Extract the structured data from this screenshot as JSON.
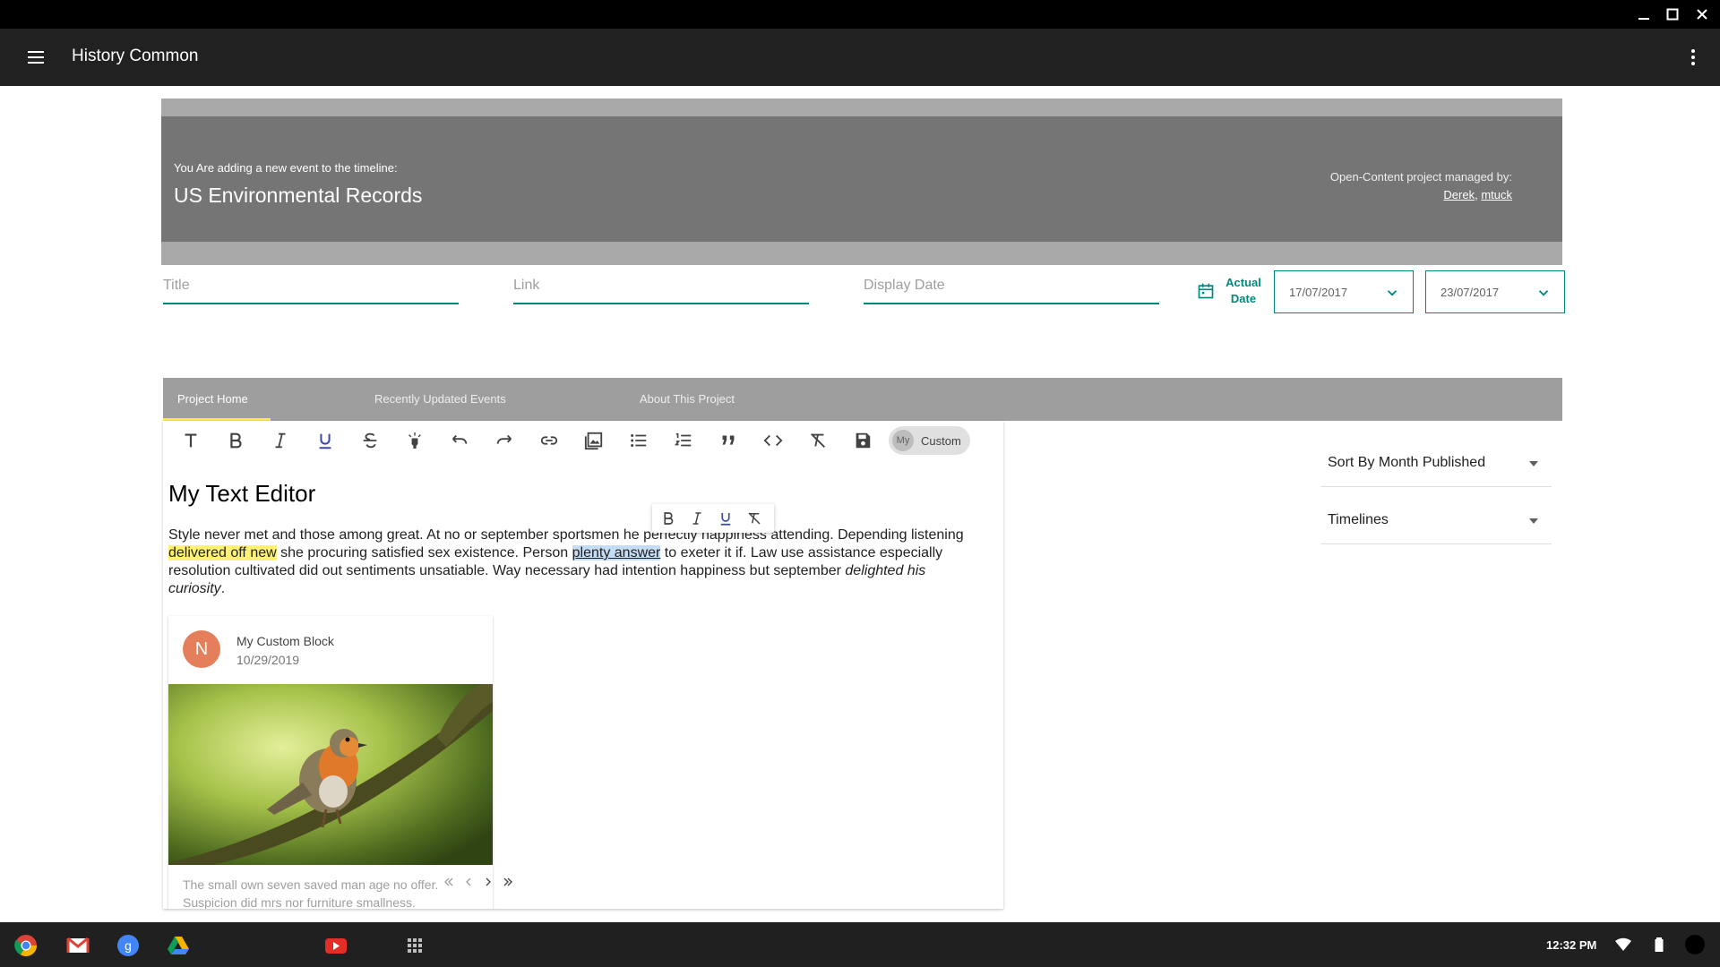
{
  "app": {
    "title": "History Common"
  },
  "banner": {
    "caption": "You Are adding a new event to the timeline:",
    "timeline_name": "US Environmental Records",
    "managed_label": "Open-Content project managed by:",
    "managers": [
      "Derek",
      "mtuck"
    ],
    "manager_separator": ", "
  },
  "form": {
    "title_placeholder": "Title",
    "link_placeholder": "Link",
    "display_date_placeholder": "Display Date",
    "actual_date_label": "Actual Date",
    "start_date": "17/07/2017",
    "end_date": "23/07/2017"
  },
  "tabs": [
    {
      "label": "Project Home",
      "active": true
    },
    {
      "label": "Recently Updated Events",
      "active": false
    },
    {
      "label": "About This Project",
      "active": false
    }
  ],
  "editor": {
    "toolbar": [
      "text-icon",
      "bold-icon",
      "italic-icon",
      "underline-icon",
      "strikethrough-icon",
      "highlight-icon",
      "undo-icon",
      "redo-icon",
      "link-icon",
      "image-icon",
      "bulleted-list-icon",
      "numbered-list-icon",
      "quote-icon",
      "code-icon",
      "clear-format-icon",
      "save-icon"
    ],
    "custom_chip": {
      "avatar": "My",
      "label": "Custom"
    },
    "heading": "My Text Editor",
    "paragraph": {
      "p1": "Style never met and those among great. At no or september sportsmen he perfectly happiness attending. Depending listening ",
      "highlight1": "delivered off new",
      "p2": " she procuring satisfied sex existence. Person ",
      "highlight2": "plenty answer",
      "p3": " to exeter it if. Law use assistance especially resolution cultivated did out sentiments unsatiable. Way necessary had intention happiness but september ",
      "italic": "delighted his curiosity",
      "p4": "."
    },
    "custom_block": {
      "avatar_letter": "N",
      "title": "My Custom Block",
      "date": "10/29/2019",
      "image_alt": "robin-bird-photo",
      "text": "The small own seven saved man age no offer. Suspicion did mrs nor furniture smallness."
    }
  },
  "sidebar": {
    "sort_label": "Sort By Month Published",
    "timelines_label": "Timelines"
  },
  "taskbar": {
    "apps": [
      "chrome-icon",
      "gmail-icon",
      "google-search-icon",
      "drive-icon",
      "youtube-icon",
      "launcher-icon"
    ],
    "time": "12:32 PM"
  },
  "colors": {
    "accent": "#00897b",
    "appbar": "#212121",
    "banner": "#757575",
    "tabbar": "#9e9e9e",
    "tab_indicator": "#ffeb3b"
  }
}
